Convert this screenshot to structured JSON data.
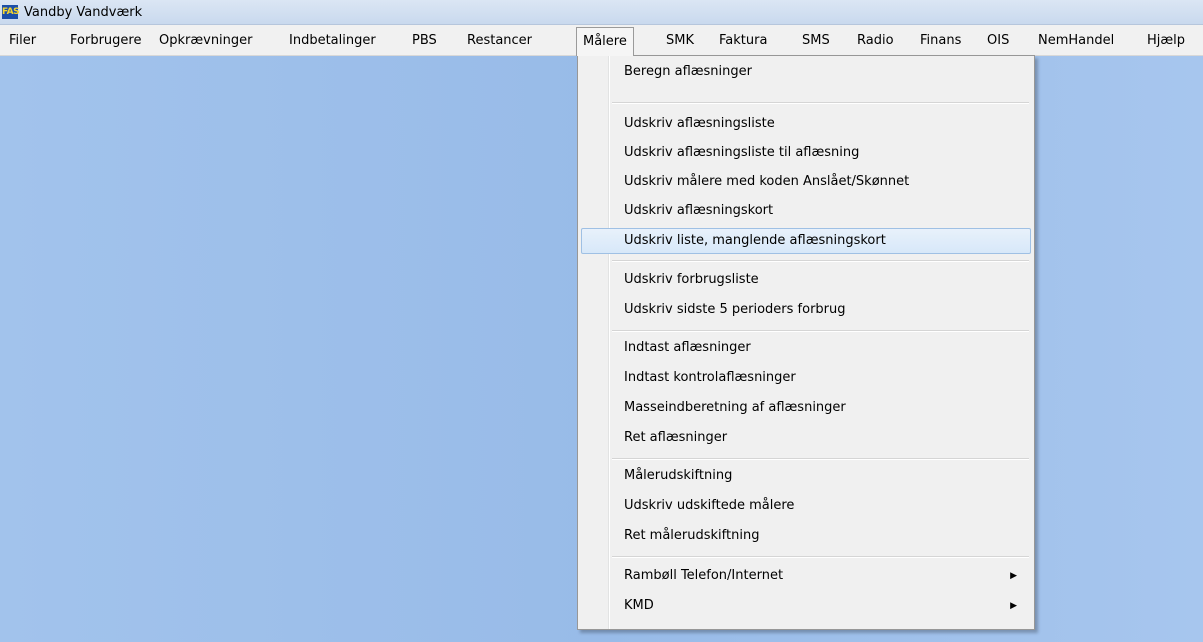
{
  "window": {
    "title": "Vandby Vandværk",
    "icon_text": "FAS"
  },
  "menubar": [
    "Filer",
    "Forbrugere",
    "Opkrævninger",
    "Indbetalinger",
    "PBS",
    "Restancer",
    "Målere",
    "SMK",
    "Faktura",
    "SMS",
    "Radio",
    "Finans",
    "OIS",
    "NemHandel",
    "Hjælp"
  ],
  "dropdown": {
    "items": [
      "Beregn aflæsninger",
      "Udskriv aflæsningsliste",
      "Udskriv aflæsningsliste til aflæsning",
      "Udskriv målere med koden Anslået/Skønnet",
      "Udskriv aflæsningskort",
      "Udskriv liste, manglende aflæsningskort",
      "Udskriv forbrugsliste",
      "Udskriv sidste 5 perioders forbrug",
      "Indtast aflæsninger",
      "Indtast kontrolaflæsninger",
      "Masseindberetning af aflæsninger",
      "Ret aflæsninger",
      "Målerudskiftning",
      "Udskriv udskiftede målere",
      "Ret målerudskiftning",
      "Rambøll Telefon/Internet",
      "KMD"
    ],
    "submenu_arrow": "▶"
  }
}
